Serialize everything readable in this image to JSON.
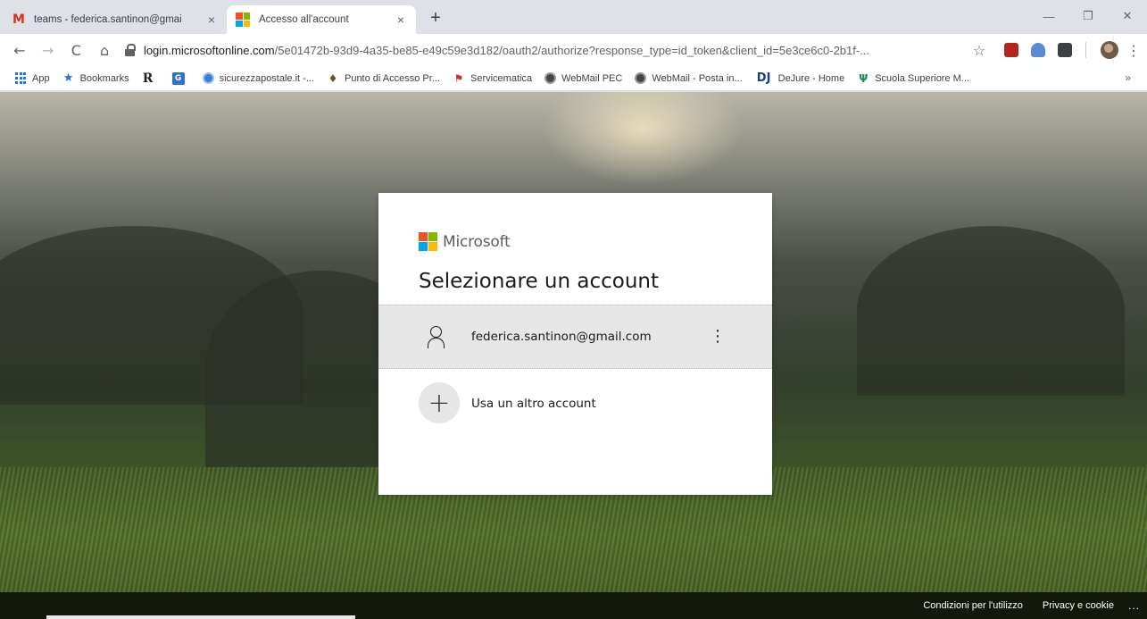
{
  "browser": {
    "tabs": [
      {
        "title": "teams - federica.santinon@gmai",
        "close": "×",
        "active": false
      },
      {
        "title": "Accesso all'account",
        "close": "×",
        "active": true
      }
    ],
    "new_tab": "+",
    "window_controls": {
      "minimize": "—",
      "restore": "❐",
      "close": "✕"
    },
    "nav": {
      "back": "←",
      "forward": "→",
      "reload": "C",
      "home": "⌂"
    },
    "address": {
      "host": "login.microsoftonline.com",
      "path": "/5e01472b-93d9-4a35-be85-e49c59e3d182/oauth2/authorize?response_type=id_token&client_id=5e3ce6c0-2b1f-..."
    },
    "toolbar_icons": [
      "star-icon",
      "pdf-extension-icon",
      "person-extension-icon",
      "box-extension-icon",
      "avatar",
      "menu-icon"
    ],
    "menu": "⋮",
    "star": "☆"
  },
  "bookmarks": {
    "items": [
      {
        "label": "App",
        "icon": "apps-grid-icon"
      },
      {
        "label": "Bookmarks",
        "icon": "star-icon"
      },
      {
        "label": "",
        "icon": "r-logo-icon",
        "glyph": "R"
      },
      {
        "label": "",
        "icon": "blue-square-icon",
        "glyph": "G"
      },
      {
        "label": "sicurezzapostale.it -...",
        "icon": "globe-icon"
      },
      {
        "label": "Punto di Accesso Pr...",
        "icon": "leaf-icon"
      },
      {
        "label": "Servicematica",
        "icon": "flag-icon"
      },
      {
        "label": "WebMail PEC",
        "icon": "globe-icon"
      },
      {
        "label": "WebMail - Posta in...",
        "icon": "globe-icon"
      },
      {
        "label": "DeJure - Home",
        "icon": "dj-logo-icon",
        "glyph": "DJ"
      },
      {
        "label": "Scuola Superiore M...",
        "icon": "ss-logo-icon",
        "glyph": "Ψ"
      }
    ],
    "more": "»"
  },
  "login": {
    "brand": "Microsoft",
    "title": "Selezionare un account",
    "account_email": "federica.santinon@gmail.com",
    "kebab": "⋮",
    "other_account_label": "Usa un altro account",
    "plus": "+"
  },
  "footer": {
    "terms": "Condizioni per l'utilizzo",
    "privacy": "Privacy e cookie",
    "more": "..."
  }
}
